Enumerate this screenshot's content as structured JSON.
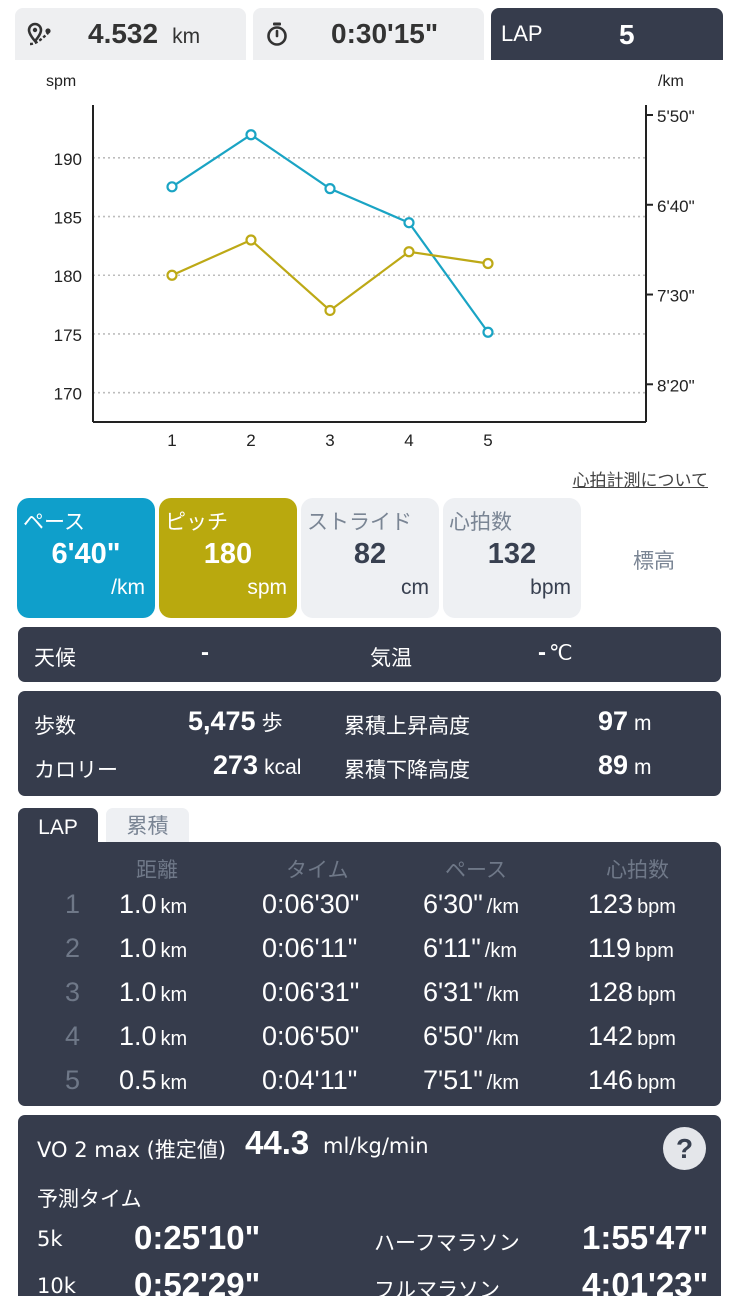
{
  "header": {
    "distance_value": "4.532",
    "distance_unit": "km",
    "time_value": "0:30'15\"",
    "lap_label": "LAP",
    "lap_value": "5",
    "distance_icon": "route-pin-icon",
    "timer_icon": "stopwatch-icon"
  },
  "chart_data": {
    "type": "line",
    "x": [
      1,
      2,
      3,
      4,
      5
    ],
    "x_ticks": [
      "1",
      "2",
      "3",
      "4",
      "5"
    ],
    "left_axis": {
      "label": "spm",
      "ticks": [
        190,
        185,
        180,
        175,
        170
      ],
      "range": [
        167.5,
        194.5
      ]
    },
    "right_axis": {
      "label": "/km",
      "ticks": [
        "5'50\"",
        "6'40\"",
        "7'30\"",
        "8'20\""
      ],
      "tick_seconds": [
        350,
        400,
        450,
        500
      ],
      "range_seconds": [
        350,
        521
      ]
    },
    "series": [
      {
        "axis": "right",
        "color": "#1aa4c4",
        "values_seconds": [
          390,
          361,
          391,
          410,
          471
        ]
      },
      {
        "axis": "left",
        "color": "#bda916",
        "values": [
          180,
          183,
          177,
          182,
          181
        ]
      }
    ],
    "grid": "horizontal dotted"
  },
  "hr_link": "心拍計測について",
  "metrics": {
    "pace": {
      "label": "ペース",
      "value": "6'40\"",
      "unit": "/km"
    },
    "pitch": {
      "label": "ピッチ",
      "value": "180",
      "unit": "spm"
    },
    "stride": {
      "label": "ストライド",
      "value": "82",
      "unit": "cm"
    },
    "heart": {
      "label": "心拍数",
      "value": "132",
      "unit": "bpm"
    },
    "altitude": {
      "label": "標高"
    }
  },
  "weather": {
    "label": "天候",
    "value": "-",
    "temp_label": "気温",
    "temp_value": "-",
    "temp_unit": "℃"
  },
  "stats": {
    "steps_label": "歩数",
    "steps_value": "5,475",
    "steps_unit": "歩",
    "calorie_label": "カロリー",
    "calorie_value": "273",
    "calorie_unit": "kcal",
    "ascent_label": "累積上昇高度",
    "ascent_value": "97",
    "ascent_unit": "m",
    "descent_label": "累積下降高度",
    "descent_value": "89",
    "descent_unit": "m"
  },
  "lap_tabs": {
    "lap": "LAP",
    "cumulative": "累積"
  },
  "lap_table": {
    "headers": {
      "distance": "距離",
      "time": "タイム",
      "pace": "ペース",
      "hr": "心拍数"
    },
    "rows": [
      {
        "n": "1",
        "dist": "1.0",
        "dist_unit": "km",
        "time": "0:06'30\"",
        "pace": "6'30\"",
        "pace_unit": "/km",
        "hr": "123",
        "hr_unit": "bpm"
      },
      {
        "n": "2",
        "dist": "1.0",
        "dist_unit": "km",
        "time": "0:06'11\"",
        "pace": "6'11\"",
        "pace_unit": "/km",
        "hr": "119",
        "hr_unit": "bpm"
      },
      {
        "n": "3",
        "dist": "1.0",
        "dist_unit": "km",
        "time": "0:06'31\"",
        "pace": "6'31\"",
        "pace_unit": "/km",
        "hr": "128",
        "hr_unit": "bpm"
      },
      {
        "n": "4",
        "dist": "1.0",
        "dist_unit": "km",
        "time": "0:06'50\"",
        "pace": "6'50\"",
        "pace_unit": "/km",
        "hr": "142",
        "hr_unit": "bpm"
      },
      {
        "n": "5",
        "dist": "0.5",
        "dist_unit": "km",
        "time": "0:04'11\"",
        "pace": "7'51\"",
        "pace_unit": "/km",
        "hr": "146",
        "hr_unit": "bpm"
      }
    ]
  },
  "vo2": {
    "label": "VO 2 max (推定値)",
    "value": "44.3",
    "unit": "ml/kg/min",
    "help": "?",
    "predict_label": "予測タイム",
    "k5_label": "5k",
    "k5_value": "0:25'10\"",
    "half_label": "ハーフマラソン",
    "half_value": "1:55'47\"",
    "k10_label": "10k",
    "k10_value": "0:52'29\"",
    "full_label": "フルマラソン",
    "full_value": "4:01'23\""
  }
}
